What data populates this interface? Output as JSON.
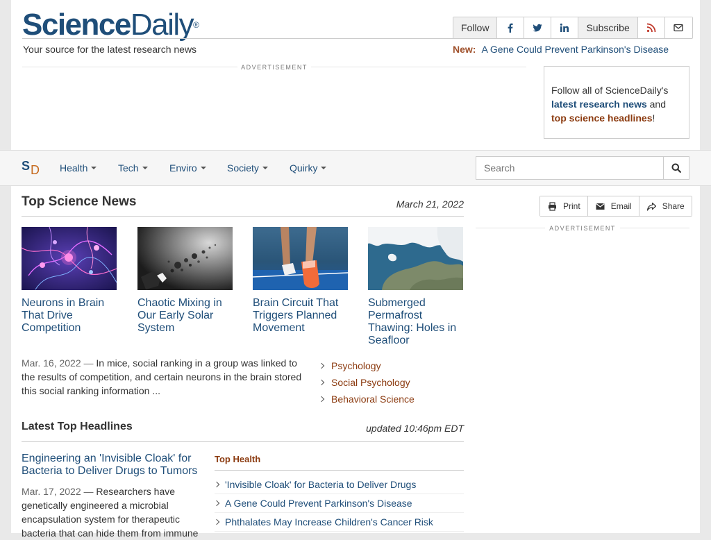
{
  "header": {
    "logo_part1": "Science",
    "logo_part2": "Daily",
    "logo_reg": "®",
    "tagline": "Your source for the latest research news",
    "follow_label": "Follow",
    "subscribe_label": "Subscribe",
    "new_label": "New:",
    "new_link": "A Gene Could Prevent Parkinson's Disease"
  },
  "ads": {
    "label": "ADVERTISEMENT"
  },
  "follow_box": {
    "text1": "Follow all of ScienceDaily's",
    "link1": "latest research news",
    "text2": "and",
    "link2": "top science headlines",
    "text3": "!"
  },
  "nav": {
    "logo_s": "S",
    "logo_d": "D",
    "items": [
      "Health",
      "Tech",
      "Enviro",
      "Society",
      "Quirky"
    ],
    "search_placeholder": "Search"
  },
  "actions": {
    "print": "Print",
    "email": "Email",
    "share": "Share"
  },
  "top_news": {
    "title": "Top Science News",
    "date": "March 21, 2022",
    "stories": [
      {
        "title": "Neurons in Brain That Drive Competition"
      },
      {
        "title": "Chaotic Mixing in Our Early Solar System"
      },
      {
        "title": "Brain Circuit That Triggers Planned Movement"
      },
      {
        "title": "Submerged Permafrost Thawing: Holes in Seafloor"
      }
    ],
    "summary_date": "Mar. 16, 2022",
    "summary_sep": "—",
    "summary_text": "In mice, social ranking in a group was linked to the results of competition, and certain neurons in the brain stored this social ranking information ...",
    "topics": [
      "Psychology",
      "Social Psychology",
      "Behavioral Science"
    ]
  },
  "headlines": {
    "title": "Latest Top Headlines",
    "updated": "updated 10:46pm EDT",
    "lead_title": "Engineering an 'Invisible Cloak' for Bacteria to Deliver Drugs to Tumors",
    "lead_date": "Mar. 17, 2022",
    "lead_sep": "—",
    "lead_text": "Researchers have genetically engineered a microbial encapsulation system for therapeutic bacteria that can hide them from immune",
    "top_health_label": "Top Health",
    "top_health": [
      "'Invisible Cloak' for Bacteria to Deliver Drugs",
      "A Gene Could Prevent Parkinson's Disease",
      "Phthalates May Increase Children's Cancer Risk"
    ]
  }
}
